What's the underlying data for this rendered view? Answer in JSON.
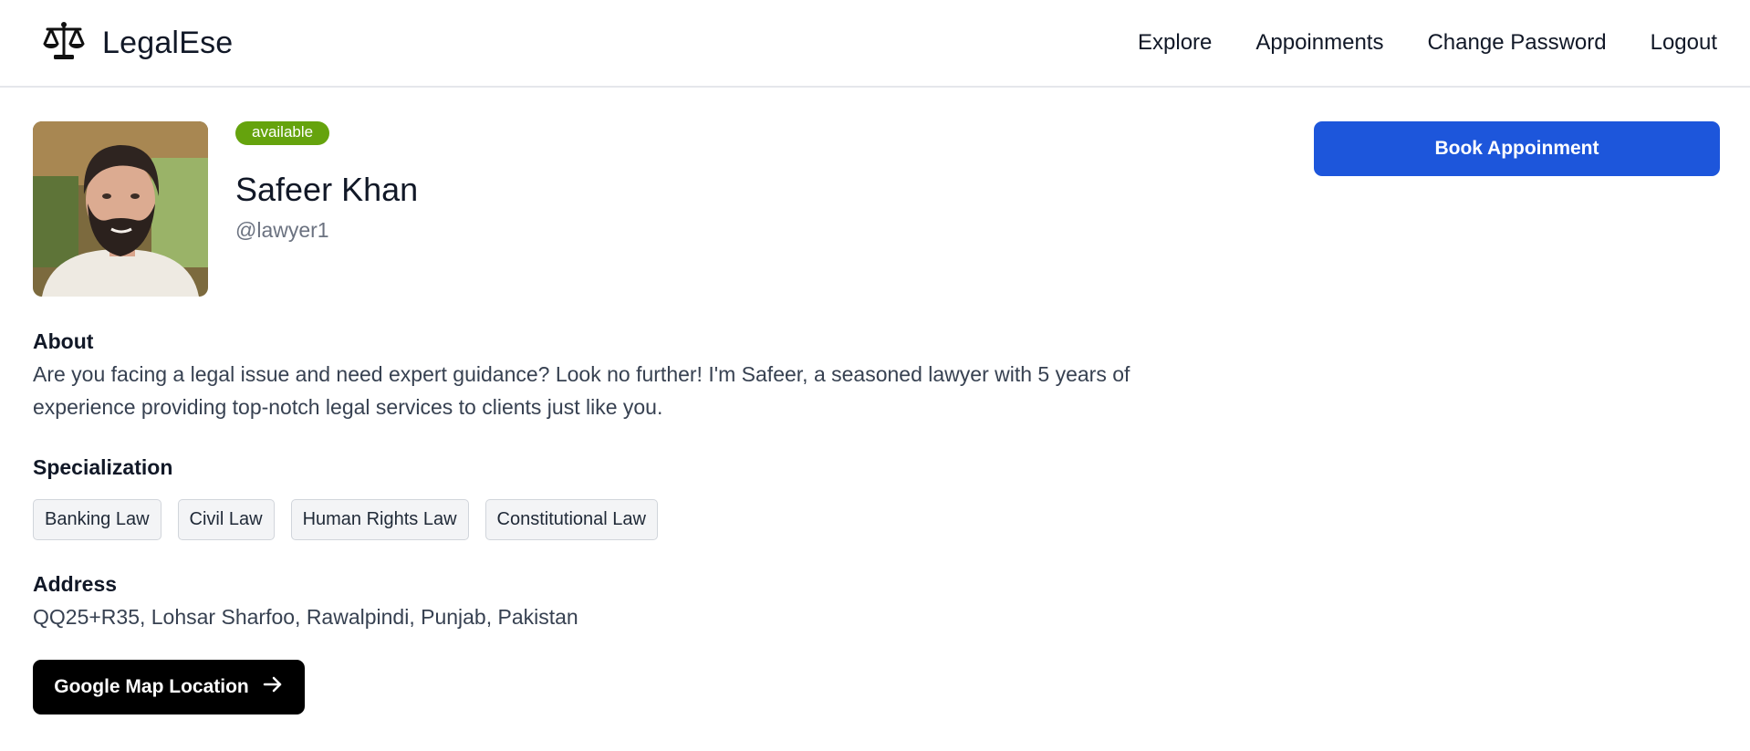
{
  "nav": {
    "brand": "LegalEse",
    "brand_icon": "scales-icon",
    "links": [
      "Explore",
      "Appoinments",
      "Change Password",
      "Logout"
    ]
  },
  "profile": {
    "status": "available",
    "name": "Safeer Khan",
    "username": "@lawyer1"
  },
  "actions": {
    "book_label": "Book Appoinment",
    "map_label": "Google Map Location",
    "map_icon": "arrow-right-icon"
  },
  "about": {
    "title": "About",
    "text": "Are you facing a legal issue and need expert guidance? Look no further! I'm Safeer, a seasoned lawyer with 5 years of experience providing top-notch legal services to clients just like you."
  },
  "specialization": {
    "title": "Specialization",
    "items": [
      "Banking Law",
      "Civil Law",
      "Human Rights Law",
      "Constitutional Law"
    ]
  },
  "address": {
    "title": "Address",
    "text": "QQ25+R35, Lohsar Sharfoo, Rawalpindi, Punjab, Pakistan"
  },
  "colors": {
    "primary_button": "#1d56db",
    "status_badge": "#65a30d",
    "map_button": "#000000"
  }
}
